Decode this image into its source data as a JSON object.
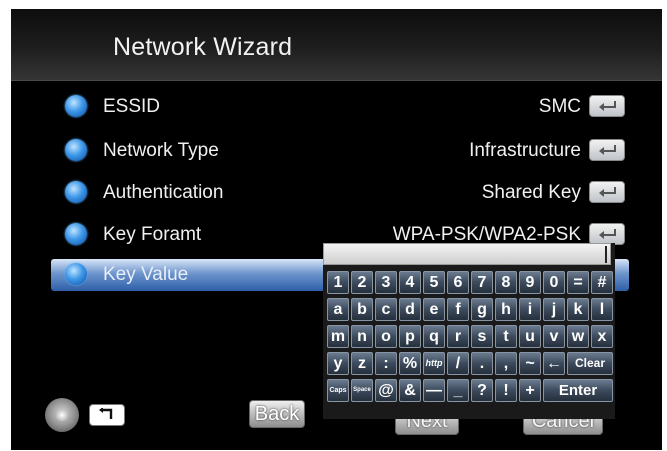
{
  "title": "Network Wizard",
  "rows": [
    {
      "label": "ESSID",
      "value": "SMC"
    },
    {
      "label": "Network Type",
      "value": "Infrastructure"
    },
    {
      "label": "Authentication",
      "value": "Shared Key"
    },
    {
      "label": "Key Foramt",
      "value": "WPA-PSK/WPA2-PSK"
    },
    {
      "label": "Key Value",
      "value": ""
    }
  ],
  "keyboard": {
    "input_value": "",
    "rows": [
      [
        "1",
        "2",
        "3",
        "4",
        "5",
        "6",
        "7",
        "8",
        "9",
        "0",
        "=",
        "#"
      ],
      [
        "a",
        "b",
        "c",
        "d",
        "e",
        "f",
        "g",
        "h",
        "i",
        "j",
        "k",
        "l"
      ],
      [
        "m",
        "n",
        "o",
        "p",
        "q",
        "r",
        "s",
        "t",
        "u",
        "v",
        "w",
        "x"
      ],
      [
        "y",
        "z",
        ":",
        "%",
        "http",
        "/",
        ".",
        ",",
        "~",
        "←",
        "Clear"
      ],
      [
        "Caps",
        "Space",
        "@",
        "&",
        "—",
        "_",
        "?",
        "!",
        "+",
        "Enter"
      ]
    ]
  },
  "buttons": {
    "back": "Back",
    "next": "Next",
    "cancel": "Cancel"
  },
  "icons": {
    "navigate": "nav-pad-icon",
    "return": "return-icon",
    "row_bullet": "blue-orb-icon",
    "enter": "enter-arrow-icon"
  },
  "colors": {
    "selected_row": "#4a79bd",
    "key_face": "#3c4a5c",
    "background": "#000000"
  }
}
